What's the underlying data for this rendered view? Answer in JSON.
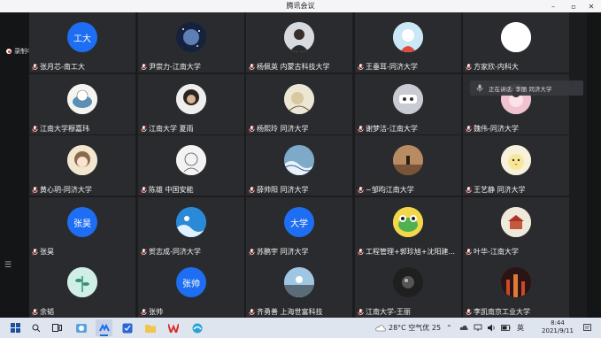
{
  "window": {
    "title": "腾讯会议"
  },
  "recording": {
    "label": "录制中"
  },
  "speaking": {
    "text": "正在讲话: 李丽 同济大学"
  },
  "participants": [
    {
      "name": "张月芯-南工大",
      "avatar": "text",
      "avatar_text": "工大",
      "color": "#1e6ef3"
    },
    {
      "name": "尹崇力-江南大学",
      "avatar": "space",
      "color": "#1b2a4a"
    },
    {
      "name": "杨佩英 内蒙古科技大学",
      "avatar": "person",
      "color": "#c9cfd6"
    },
    {
      "name": "王垂耳-同济大学",
      "avatar": "blue",
      "color": "#bfe3f5"
    },
    {
      "name": "方家欣-内科大",
      "avatar": "blank",
      "color": "#ffffff"
    },
    {
      "name": "江南大学穆嘉玮",
      "avatar": "cartoon",
      "color": "#f4f2ee"
    },
    {
      "name": "江南大学 夏雨",
      "avatar": "curly",
      "color": "#e8e8e8"
    },
    {
      "name": "杨熙玲 同济大学",
      "avatar": "drawing",
      "color": "#ece6d5"
    },
    {
      "name": "谢梦洁-江南大学",
      "avatar": "mask",
      "color": "#c8ccd2"
    },
    {
      "name": "魏伟-同济大学",
      "avatar": "pink",
      "color": "#efc3cf"
    },
    {
      "name": "黄心玥-同济大学",
      "avatar": "anime",
      "color": "#efe2c8"
    },
    {
      "name": "陈雄 中国安能",
      "avatar": "sketch",
      "color": "#f2f2f2"
    },
    {
      "name": "薛帅阳 同济大学",
      "avatar": "wave",
      "color": "#7ea9c9"
    },
    {
      "name": "~邹昀江南大学",
      "avatar": "desert",
      "color": "#9c6f4c"
    },
    {
      "name": "王艺静 同济大学",
      "avatar": "chick",
      "color": "#f5eed8"
    },
    {
      "name": "张昊",
      "avatar": "text",
      "avatar_text": "张昊",
      "color": "#1e6ef3"
    },
    {
      "name": "贺志成-同济大学",
      "avatar": "ocean",
      "color": "#2a8ad8"
    },
    {
      "name": "苏鹏宇 同济大学",
      "avatar": "text",
      "avatar_text": "大学",
      "color": "#1e6ef3"
    },
    {
      "name": "工程管理+郭珍旭+沈阳建...",
      "avatar": "frog",
      "color": "#f4d64a"
    },
    {
      "name": "叶华-江南大学",
      "avatar": "temple",
      "color": "#efe9dc"
    },
    {
      "name": "余韬",
      "avatar": "plant",
      "color": "#cfeee6"
    },
    {
      "name": "张帅",
      "avatar": "text",
      "avatar_text": "张帅",
      "color": "#1e6ef3"
    },
    {
      "name": "齐勇善 上海世富科技",
      "avatar": "sky",
      "color": "#9fc6e3"
    },
    {
      "name": "江南大学-王丽",
      "avatar": "dark",
      "color": "#2b2b2b"
    },
    {
      "name": "李凯南京工业大学",
      "avatar": "night",
      "color": "#3a1a1a"
    }
  ],
  "taskbar": {
    "weather": "28°C 空气优 25",
    "input_mode": "英",
    "time": "8:44",
    "date": "2021/9/11"
  }
}
